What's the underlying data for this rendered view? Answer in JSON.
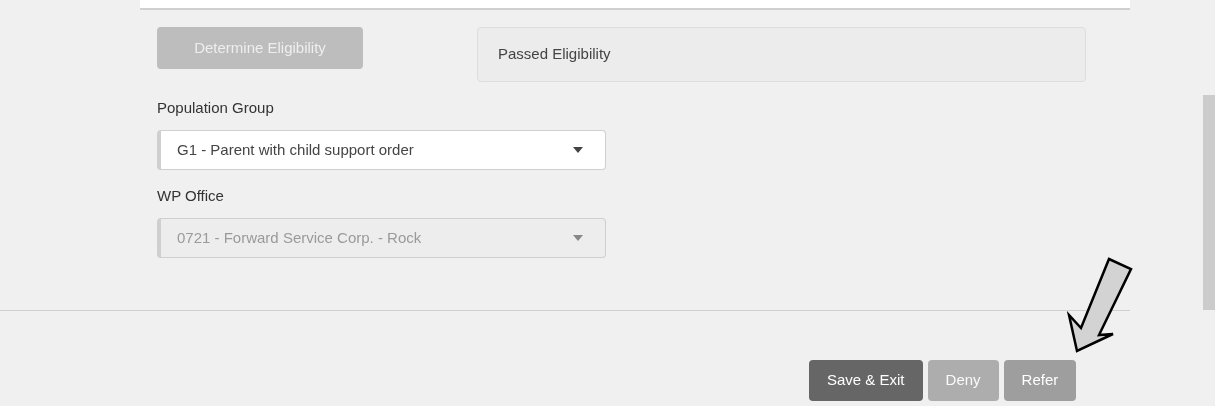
{
  "eligibility": {
    "button": {
      "label": "Determine Eligibility",
      "disabled": true
    },
    "result": "Passed Eligibility"
  },
  "fields": [
    {
      "label": "Population Group",
      "value": "G1 - Parent with child support order",
      "disabled": false
    },
    {
      "label": "WP Office",
      "value": "0721 - Forward Service Corp. - Rock",
      "disabled": true
    }
  ],
  "actions": [
    {
      "label": "Save & Exit",
      "kind": "primary",
      "disabled": false
    },
    {
      "label": "Deny",
      "kind": "secondary",
      "disabled": true
    },
    {
      "label": "Refer",
      "kind": "secondary",
      "disabled": false
    }
  ]
}
